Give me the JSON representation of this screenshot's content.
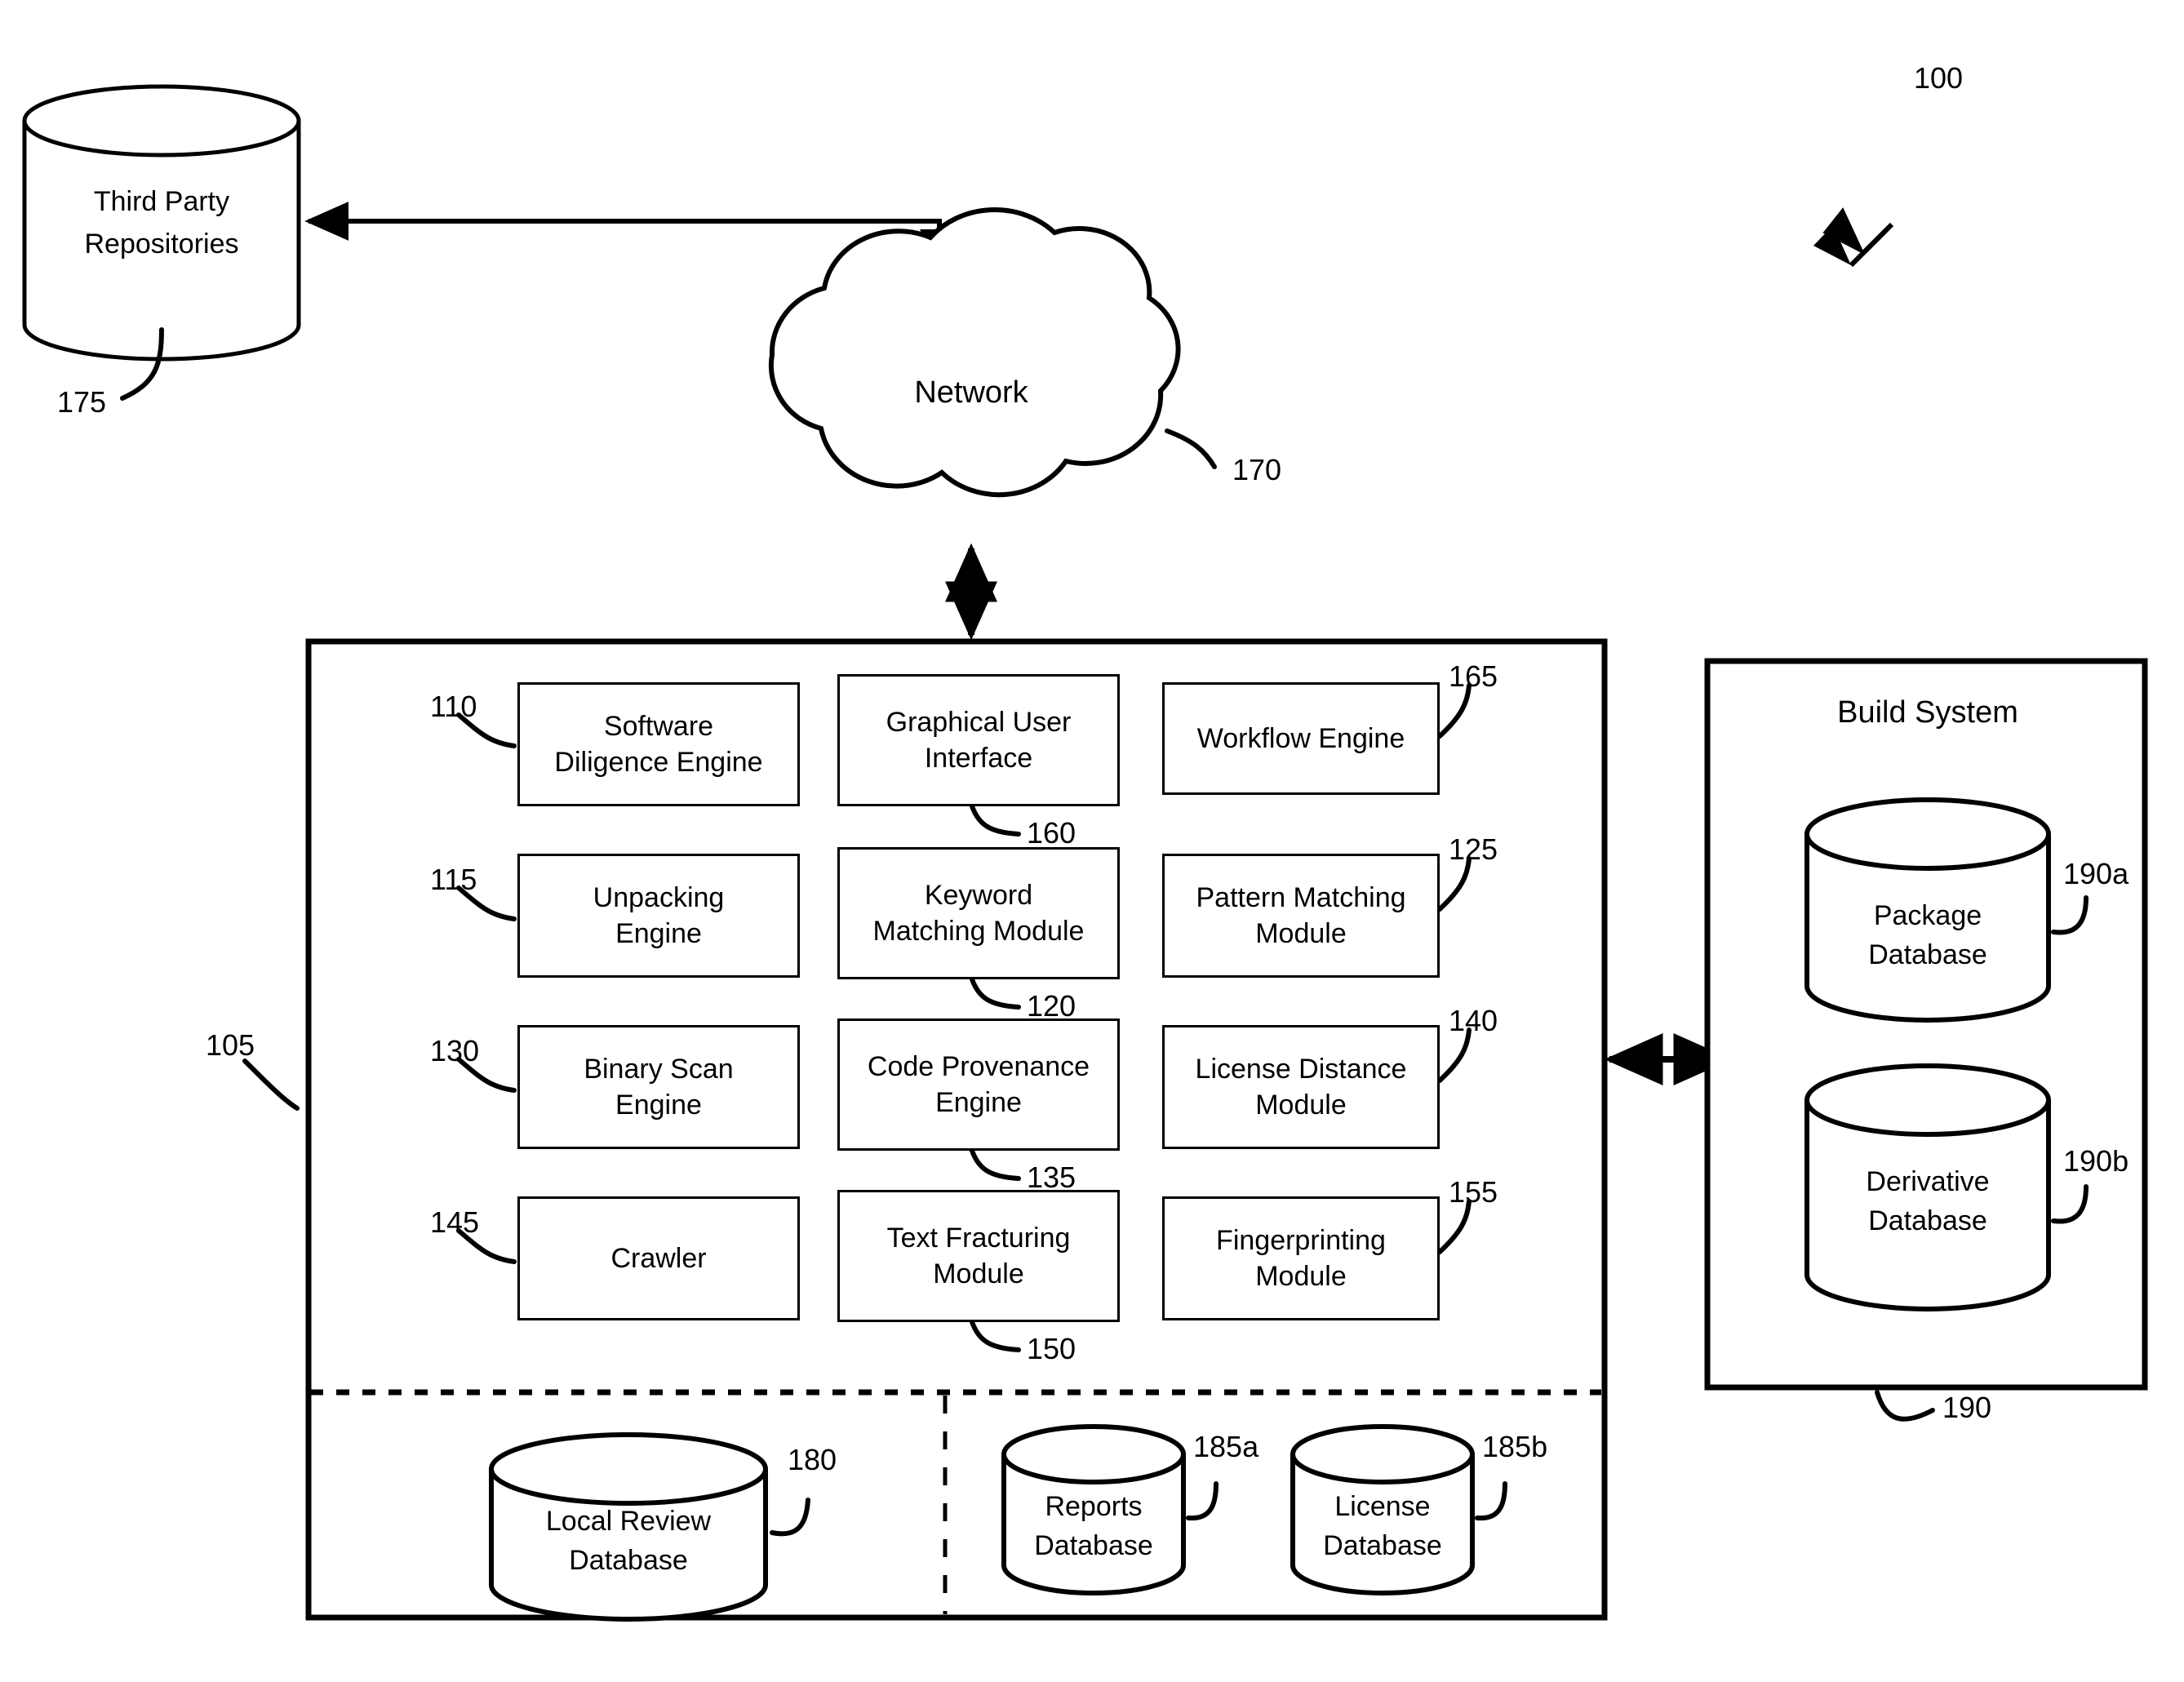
{
  "figure": {
    "figure_ref": "100",
    "system_ref": "105"
  },
  "third_party": {
    "line1": "Third Party",
    "line2": "Repositories",
    "ref": "175"
  },
  "network": {
    "label": "Network",
    "ref": "170"
  },
  "modules": [
    {
      "line1": "Software",
      "line2": "Diligence Engine",
      "ref": "110",
      "ref_side": "left"
    },
    {
      "line1": "Graphical User",
      "line2": "Interface",
      "ref": "160",
      "ref_side": "below"
    },
    {
      "line1": "Workflow Engine",
      "line2": "",
      "ref": "165",
      "ref_side": "right"
    },
    {
      "line1": "Unpacking",
      "line2": "Engine",
      "ref": "115",
      "ref_side": "left"
    },
    {
      "line1": "Keyword",
      "line2": "Matching Module",
      "ref": "120",
      "ref_side": "below"
    },
    {
      "line1": "Pattern Matching",
      "line2": "Module",
      "ref": "125",
      "ref_side": "right"
    },
    {
      "line1": "Binary Scan",
      "line2": "Engine",
      "ref": "130",
      "ref_side": "left"
    },
    {
      "line1": "Code Provenance",
      "line2": "Engine",
      "ref": "135",
      "ref_side": "below"
    },
    {
      "line1": "License Distance",
      "line2": "Module",
      "ref": "140",
      "ref_side": "right"
    },
    {
      "line1": "Crawler",
      "line2": "",
      "ref": "145",
      "ref_side": "left"
    },
    {
      "line1": "Text Fracturing",
      "line2": "Module",
      "ref": "150",
      "ref_side": "below"
    },
    {
      "line1": "Fingerprinting",
      "line2": "Module",
      "ref": "155",
      "ref_side": "right"
    }
  ],
  "local_databases": [
    {
      "line1": "Local Review",
      "line2": "Database",
      "ref": "180"
    },
    {
      "line1": "Reports",
      "line2": "Database",
      "ref": "185a"
    },
    {
      "line1": "License",
      "line2": "Database",
      "ref": "185b"
    }
  ],
  "build_system": {
    "title": "Build System",
    "ref": "190",
    "databases": [
      {
        "line1": "Package",
        "line2": "Database",
        "ref": "190a"
      },
      {
        "line1": "Derivative",
        "line2": "Database",
        "ref": "190b"
      }
    ]
  },
  "colors": {
    "stroke": "#000000",
    "background": "#ffffff"
  }
}
